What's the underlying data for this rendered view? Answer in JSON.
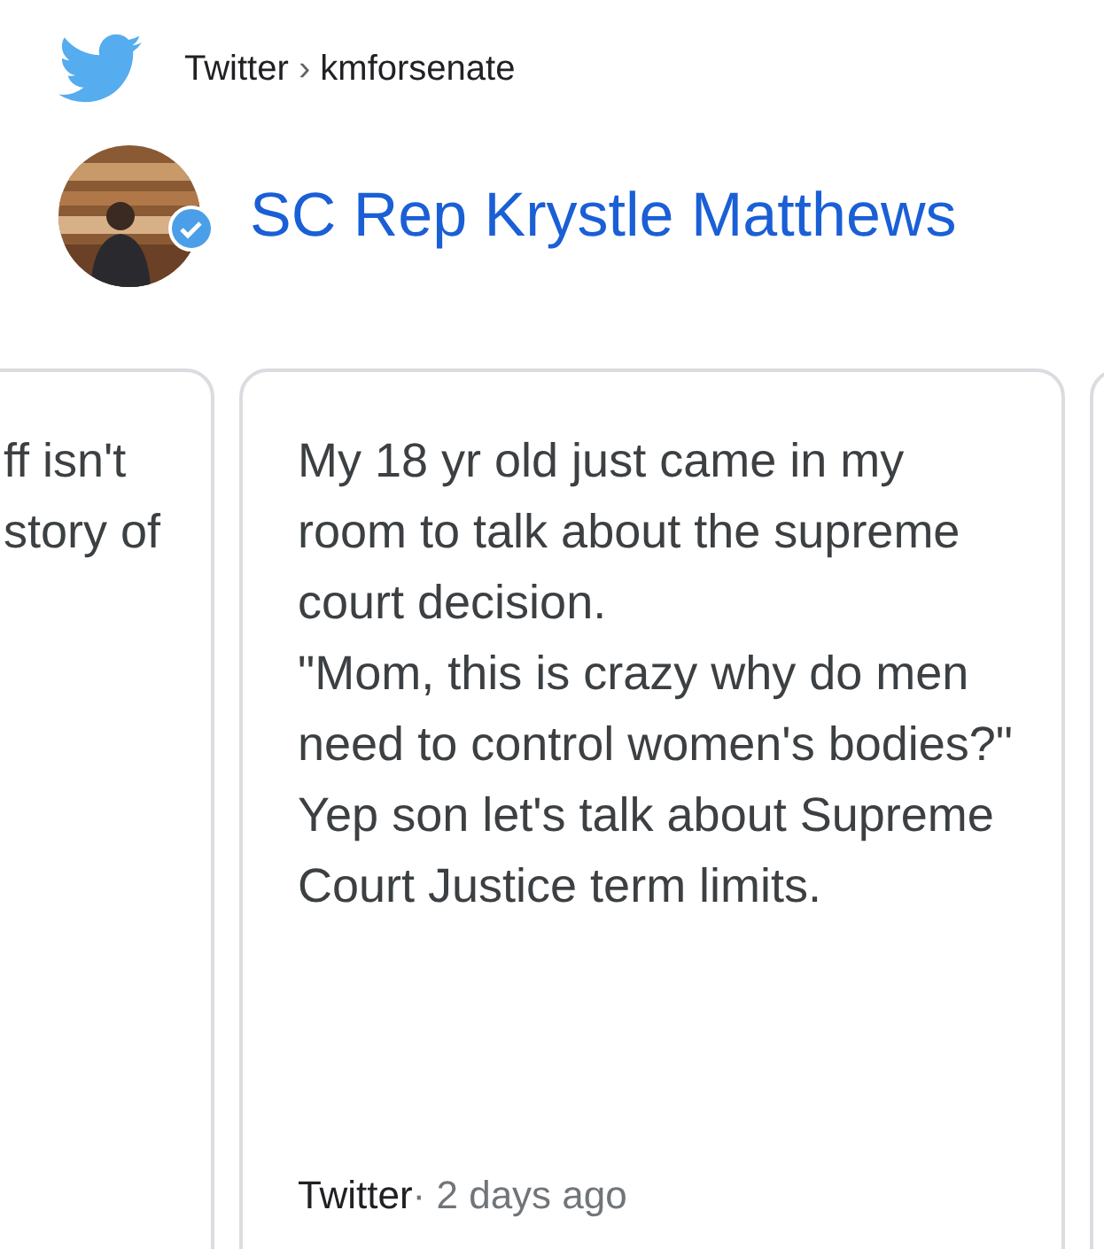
{
  "source": {
    "site": "Twitter",
    "separator": "›",
    "handle": "kmforsenate"
  },
  "account": {
    "name": "SC Rep Krystle Matthews",
    "verified": true
  },
  "previous_card": {
    "lines": [
      "ff isn't",
      "story of"
    ]
  },
  "card": {
    "text": "My 18 yr old just came in my room to talk about the supreme court decision.\n\"Mom, this is crazy why do men need to control women's bodies?\" Yep son let's talk about Supreme Court Justice term limits.",
    "site": "Twitter",
    "separator": "·",
    "time": "2 days ago"
  }
}
